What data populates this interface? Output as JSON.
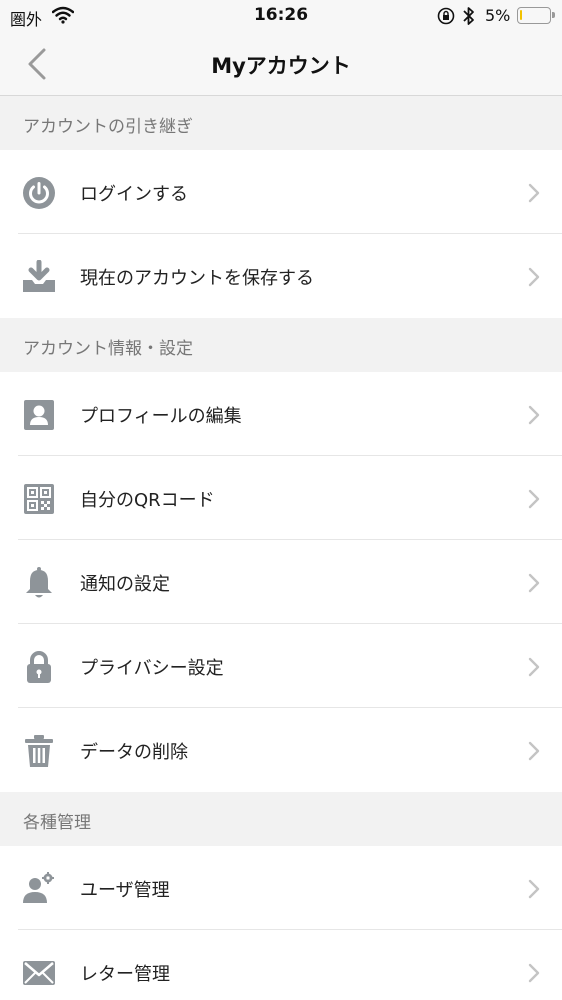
{
  "status_bar": {
    "carrier": "圏外",
    "time": "16:26",
    "battery_percent": "5%",
    "battery_level": 0.05,
    "icons": [
      "wifi-icon",
      "orientation-lock-icon",
      "bluetooth-icon",
      "battery-icon"
    ]
  },
  "nav": {
    "title": "Myアカウント",
    "back_icon": "chevron-left-icon"
  },
  "sections": [
    {
      "header": "アカウントの引き継ぎ",
      "items": [
        {
          "label": "ログインする",
          "icon": "power-icon"
        },
        {
          "label": "現在のアカウントを保存する",
          "icon": "download-tray-icon"
        }
      ]
    },
    {
      "header": "アカウント情報・設定",
      "items": [
        {
          "label": "プロフィールの編集",
          "icon": "profile-card-icon"
        },
        {
          "label": "自分のQRコード",
          "icon": "qr-code-icon"
        },
        {
          "label": "通知の設定",
          "icon": "bell-icon"
        },
        {
          "label": "プライバシー設定",
          "icon": "padlock-icon"
        },
        {
          "label": "データの削除",
          "icon": "trash-icon"
        }
      ]
    },
    {
      "header": "各種管理",
      "items": [
        {
          "label": "ユーザ管理",
          "icon": "user-settings-icon"
        },
        {
          "label": "レター管理",
          "icon": "envelope-icon"
        }
      ]
    }
  ],
  "colors": {
    "icon_gray": "#8e9499",
    "chevron_gray": "#c4c4c4",
    "section_bg": "#f2f2f2",
    "battery_yellow": "#f2c200"
  }
}
